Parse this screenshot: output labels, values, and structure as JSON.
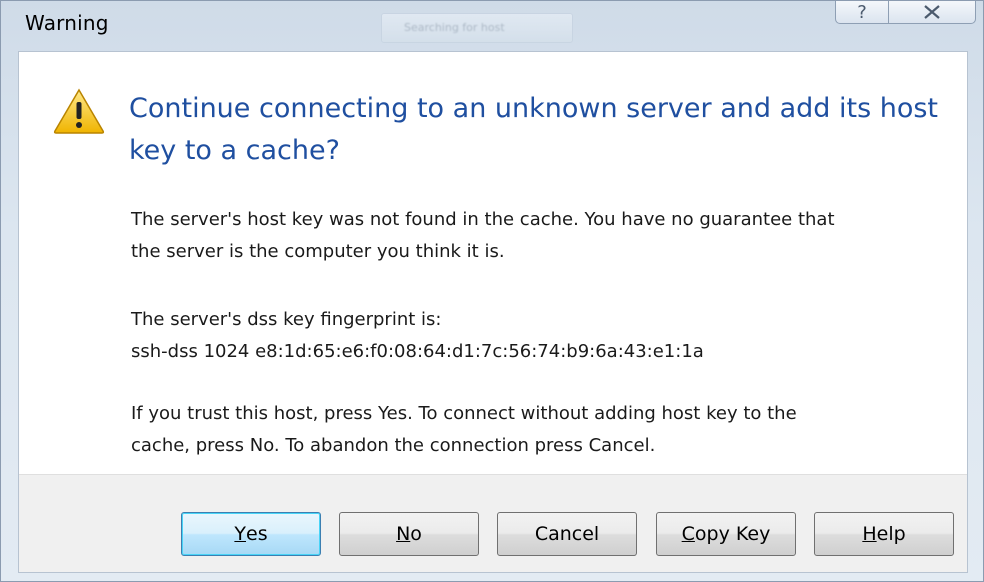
{
  "window": {
    "title": "Warning",
    "background_hint": "Searching for host"
  },
  "icons": {
    "warning": "warning-triangle-icon",
    "help": "question-mark-icon",
    "close": "close-x-icon"
  },
  "dialog": {
    "main_instruction": "Continue connecting to an unknown server and add its host key to a cache?",
    "paragraph1": [
      "The server's host key was not found in the cache. You have no guarantee that",
      "the server is the computer you think it is."
    ],
    "paragraph2": [
      "The server's dss key fingerprint is:",
      "ssh-dss 1024 e8:1d:65:e6:f0:08:64:d1:7c:56:74:b9:6a:43:e1:1a"
    ],
    "paragraph3": [
      "If you trust this host, press Yes. To connect without adding host key to the",
      "cache, press No. To abandon the connection press Cancel."
    ]
  },
  "buttons": {
    "yes": {
      "mnemonic": "Y",
      "rest": "es"
    },
    "no": {
      "mnemonic": "N",
      "rest": "o"
    },
    "cancel": {
      "label": "Cancel"
    },
    "copy_key": {
      "mnemonic": "C",
      "rest": "opy Key"
    },
    "help": {
      "mnemonic": "H",
      "rest": "elp"
    }
  },
  "colors": {
    "instruction": "#1f4fa0",
    "default_button_border": "#3c7fb1",
    "warning_fill": "#f5c518"
  }
}
